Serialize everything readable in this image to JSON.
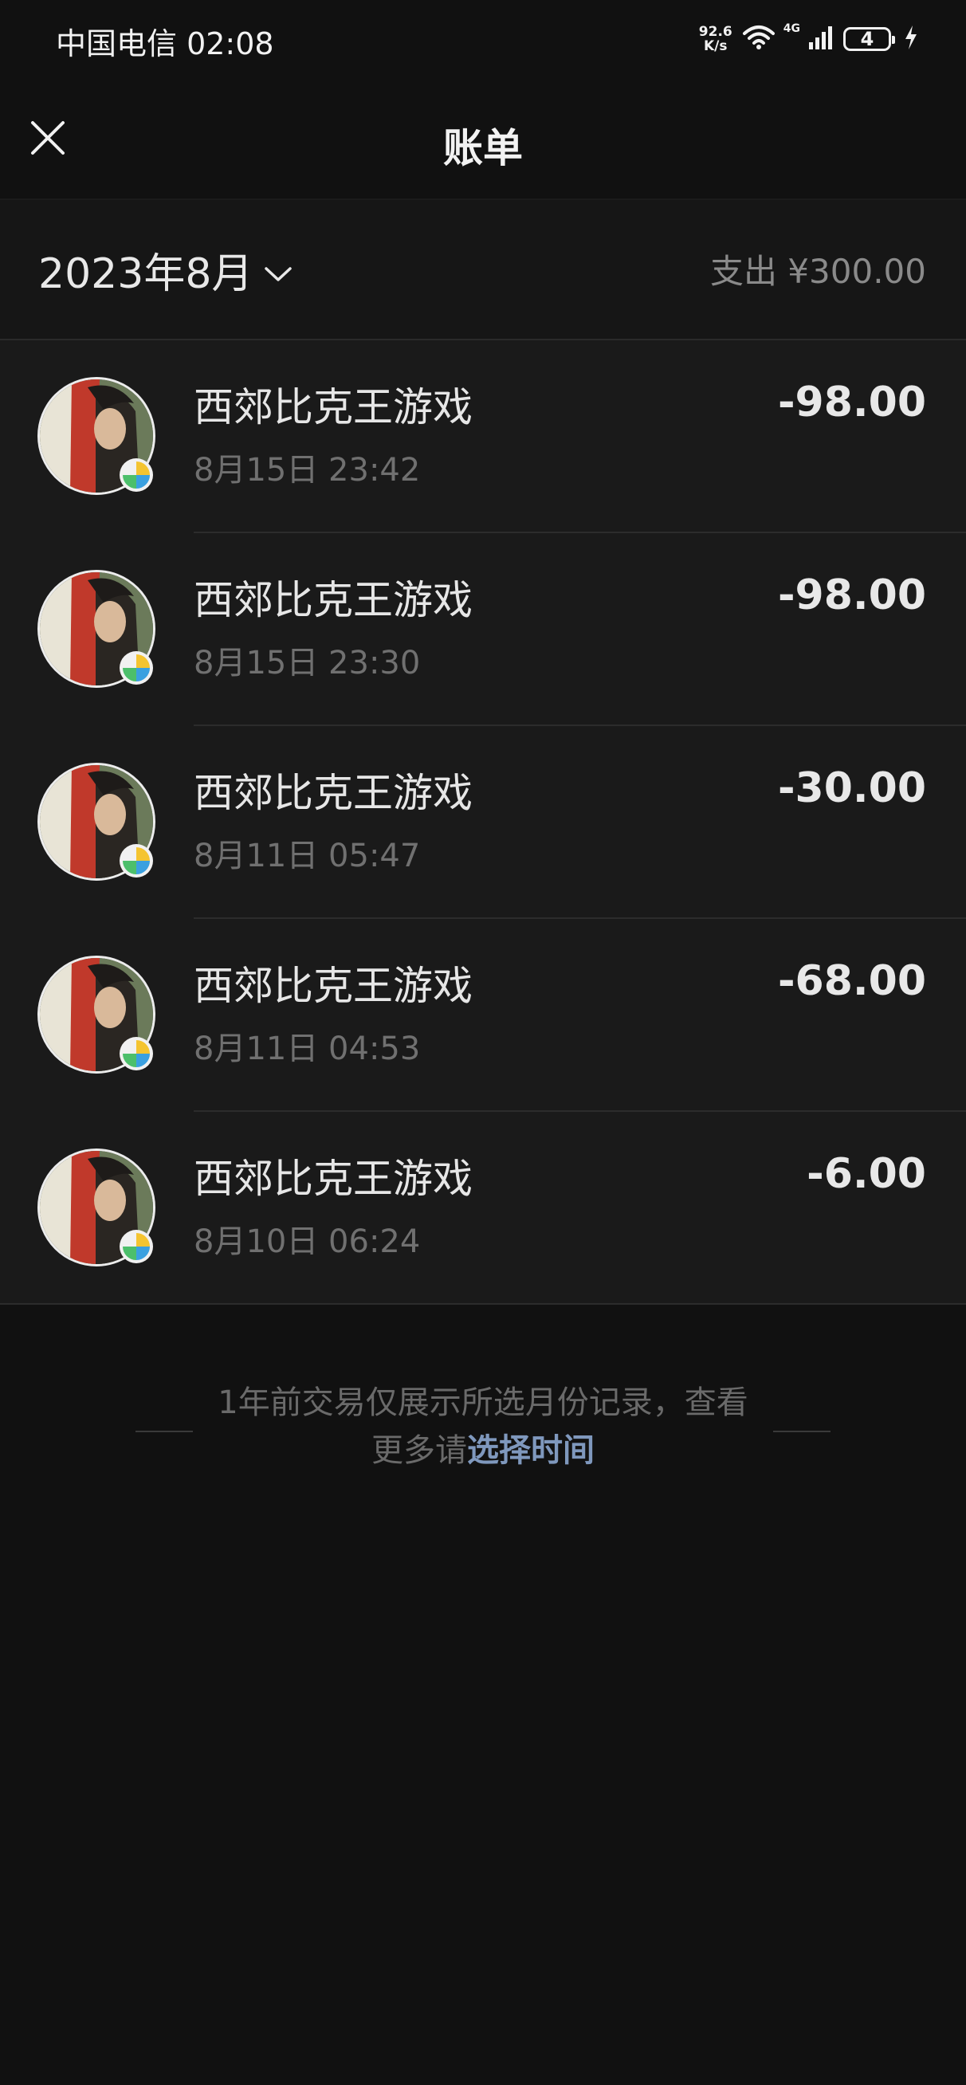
{
  "status_bar": {
    "carrier_time": "中国电信 02:08",
    "net_speed_value": "92.6",
    "net_speed_unit": "K/s",
    "signal_tag": "4G",
    "battery_level": "4",
    "icons": [
      "wifi-icon",
      "signal-icon",
      "battery-icon",
      "charging-icon"
    ]
  },
  "header": {
    "title": "账单",
    "close_icon": "close-icon"
  },
  "month_bar": {
    "month_label": "2023年8月",
    "expense_summary": "支出 ¥300.00"
  },
  "transactions": [
    {
      "name": "西郊比克王游戏",
      "time": "8月15日 23:42",
      "amount": "-98.00"
    },
    {
      "name": "西郊比克王游戏",
      "time": "8月15日 23:30",
      "amount": "-98.00"
    },
    {
      "name": "西郊比克王游戏",
      "time": "8月11日 05:47",
      "amount": "-30.00"
    },
    {
      "name": "西郊比克王游戏",
      "time": "8月11日 04:53",
      "amount": "-68.00"
    },
    {
      "name": "西郊比克王游戏",
      "time": "8月10日 06:24",
      "amount": "-6.00"
    }
  ],
  "footer": {
    "note_prefix": "1年前交易仅展示所选月份记录，查看更多请",
    "note_link": "选择时间"
  },
  "colors": {
    "background": "#111111",
    "list_background": "#1a1a1a",
    "link": "#7f98bd"
  }
}
